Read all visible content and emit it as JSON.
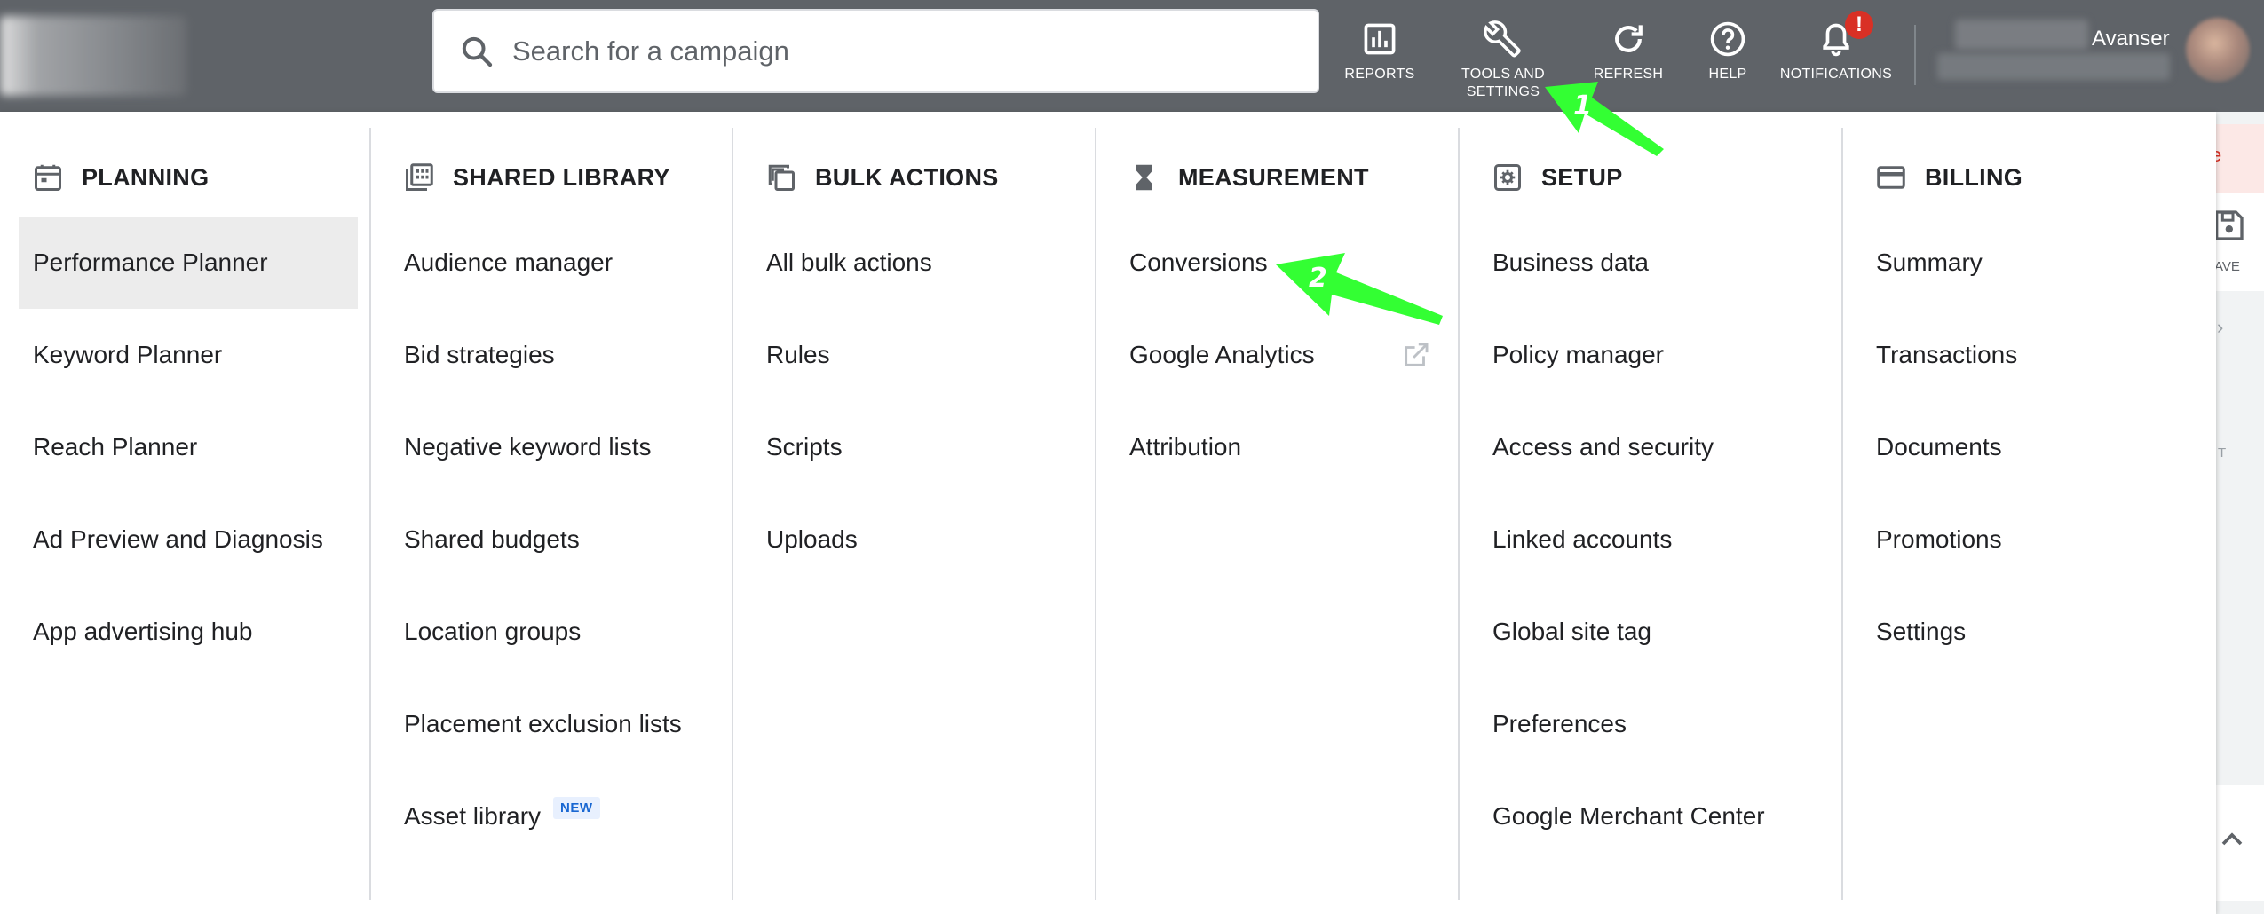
{
  "search": {
    "placeholder": "Search for a campaign"
  },
  "toolbar": [
    {
      "label": "REPORTS",
      "icon": "reports-icon"
    },
    {
      "label": "TOOLS AND\nSETTINGS",
      "icon": "wrench-icon"
    },
    {
      "label": "REFRESH",
      "icon": "refresh-icon"
    },
    {
      "label": "HELP",
      "icon": "help-icon"
    },
    {
      "label": "NOTIFICATIONS",
      "icon": "bell-icon"
    }
  ],
  "notification_badge": "!",
  "account": {
    "name": "Avanser"
  },
  "menu": {
    "planning": {
      "title": "PLANNING",
      "items": [
        "Performance Planner",
        "Keyword Planner",
        "Reach Planner",
        "Ad Preview and Diagnosis",
        "App advertising hub"
      ]
    },
    "shared_library": {
      "title": "SHARED LIBRARY",
      "items": [
        "Audience manager",
        "Bid strategies",
        "Negative keyword lists",
        "Shared budgets",
        "Location groups",
        "Placement exclusion lists",
        "Asset library"
      ],
      "new_badge": "NEW"
    },
    "bulk_actions": {
      "title": "BULK ACTIONS",
      "items": [
        "All bulk actions",
        "Rules",
        "Scripts",
        "Uploads"
      ]
    },
    "measurement": {
      "title": "MEASUREMENT",
      "items": [
        "Conversions",
        "Google Analytics",
        "Attribution"
      ]
    },
    "setup": {
      "title": "SETUP",
      "items": [
        "Business data",
        "Policy manager",
        "Access and security",
        "Linked accounts",
        "Global site tag",
        "Preferences",
        "Google Merchant Center"
      ]
    },
    "billing": {
      "title": "BILLING",
      "items": [
        "Summary",
        "Transactions",
        "Documents",
        "Promotions",
        "Settings"
      ]
    }
  },
  "right_partial": {
    "save_label": "AVE",
    "letter_e": "e",
    "letter_t": "T"
  },
  "annotations": {
    "arrow1": "1",
    "arrow2": "2",
    "color": "#33ff33"
  },
  "colors": {
    "topbar": "#5f6368",
    "active_item_bg": "#ececec",
    "badge_red": "#d93025",
    "new_badge_blue": "#1967d2"
  }
}
